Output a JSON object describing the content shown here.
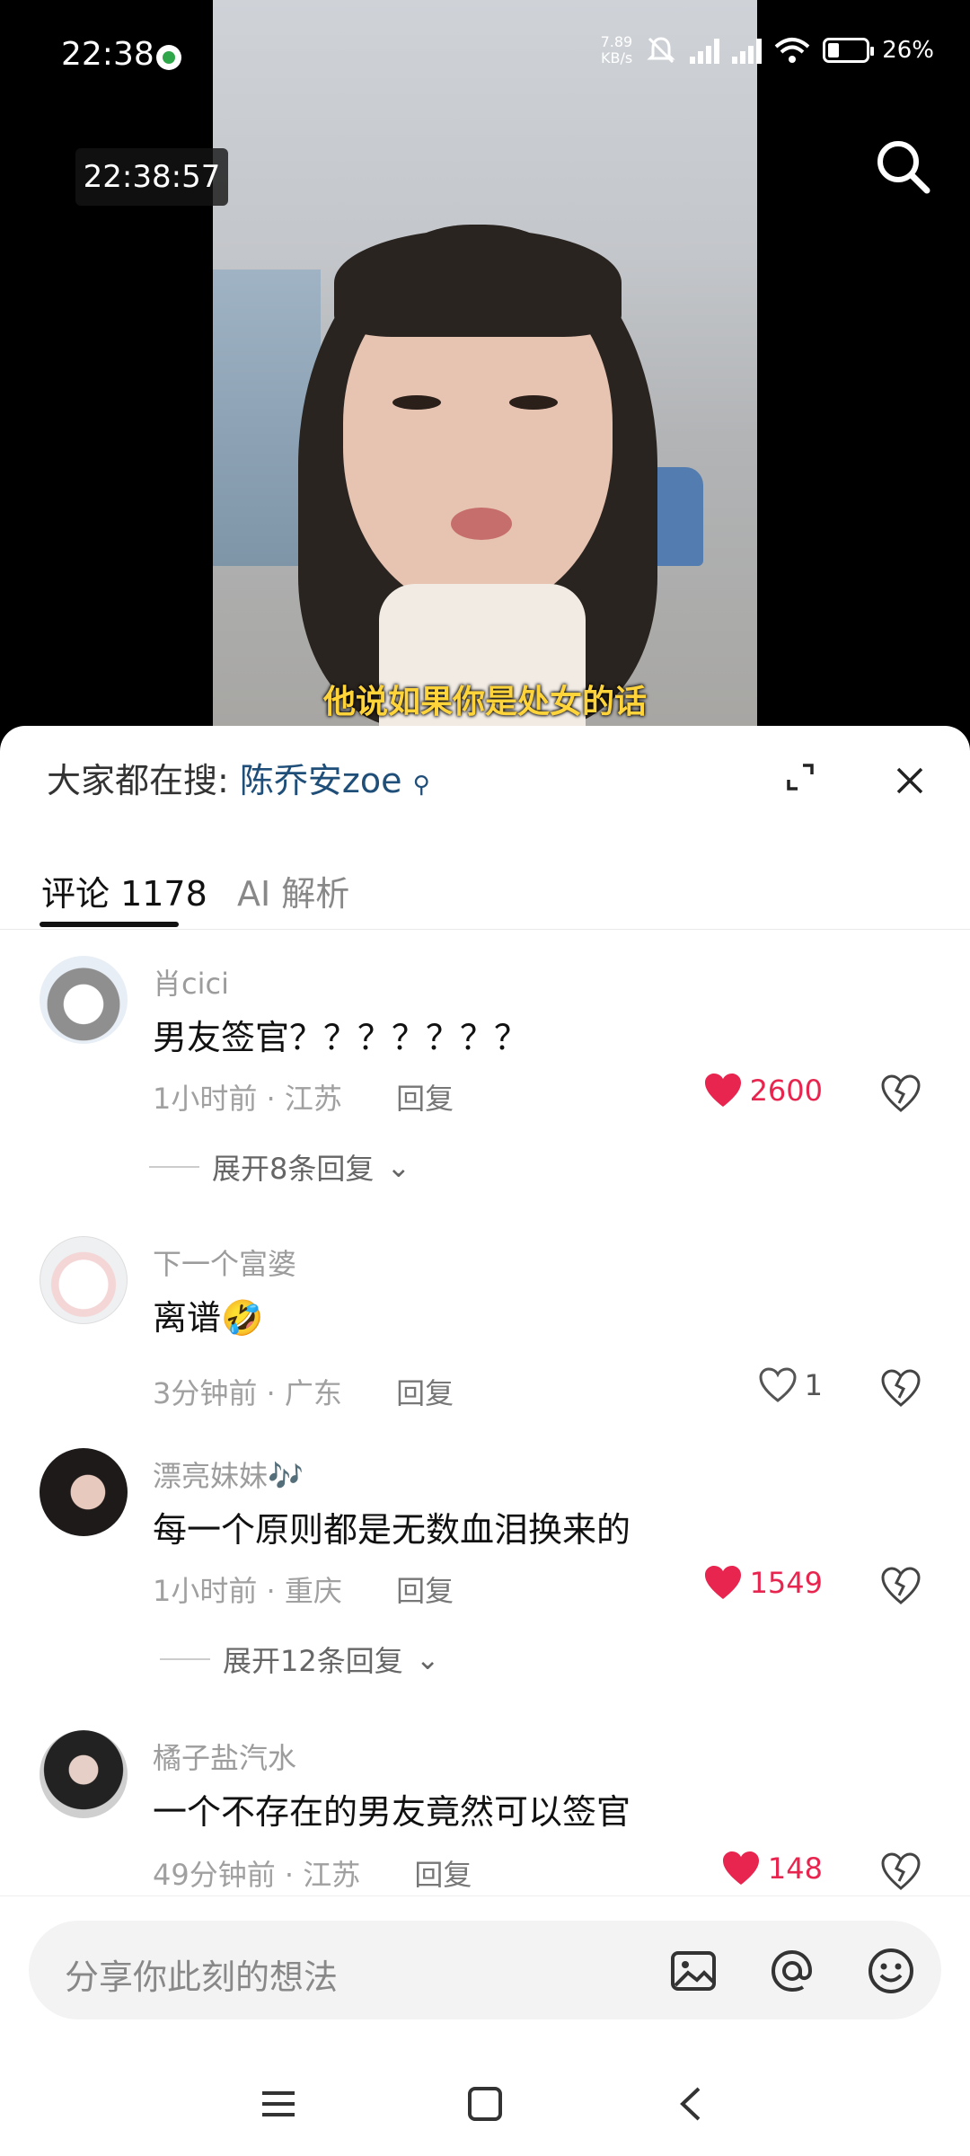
{
  "status_bar": {
    "time": "22:38",
    "net_speed": "7.89",
    "net_unit": "KB/s",
    "signal1": "5G",
    "signal2": "5G",
    "battery": "26%"
  },
  "video": {
    "timestamp": "22:38:57",
    "subtitle": "他说如果你是处女的话"
  },
  "comments_panel": {
    "search_prefix": "大家都在搜:",
    "search_keyword": "陈乔安zoe",
    "tabs": [
      {
        "label": "评论 1178"
      },
      {
        "label": "AI 解析"
      }
    ],
    "comments": [
      {
        "username": "肖cici",
        "text": "男友签官？？？？？？？",
        "time_location": "1小时前 · 江苏",
        "reply": "回复",
        "likes": "2600",
        "liked": true,
        "expand": "展开8条回复"
      },
      {
        "username": "下一个富婆",
        "text": "离谱",
        "time_location": "3分钟前 · 广东",
        "reply": "回复",
        "likes": "1",
        "liked": false
      },
      {
        "username": "漂亮妹妹🎶",
        "text": "每一个原则都是无数血泪换来的",
        "time_location": "1小时前 · 重庆",
        "reply": "回复",
        "likes": "1549",
        "liked": true,
        "expand": "展开12条回复"
      },
      {
        "username": "橘子盐汽水",
        "text": "一个不存在的男友竟然可以签官",
        "time_location": "49分钟前 · 江苏",
        "reply": "回复",
        "likes": "148",
        "liked": true
      }
    ],
    "input_placeholder": "分享你此刻的想法"
  },
  "colors": {
    "like_red": "#e8254f",
    "keyword_blue": "#1f4e79",
    "subtitle_yellow": "#ffd43b"
  },
  "icons": [
    "search-icon",
    "expand-icon",
    "close-icon",
    "heart-icon",
    "dislike-icon",
    "image-icon",
    "at-icon",
    "emoji-icon",
    "menu-icon",
    "home-icon",
    "back-icon"
  ]
}
